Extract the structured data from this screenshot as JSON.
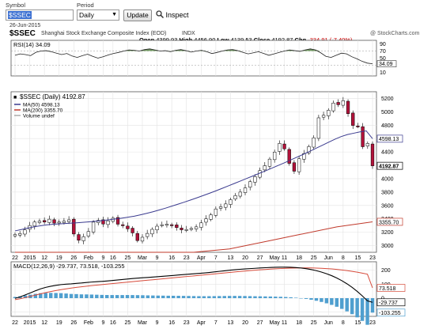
{
  "toolbar": {
    "symbol_caption": "Symbol",
    "symbol_value": "$SSEC",
    "period_caption": "Period",
    "period_value": "Daily",
    "update_label": "Update",
    "inspect_label": "Inspect"
  },
  "header": {
    "date": "26-Jun-2015",
    "symbol": "$SSEC",
    "name": "Shanghai Stock Exchange Composite Index (EOD)",
    "exchange": "INDX",
    "watermark": "@ StockCharts.com",
    "open_label": "Open",
    "open_value": "4399.93",
    "high_label": "High",
    "high_value": "4456.90",
    "low_label": "Low",
    "low_value": "4139.53",
    "close_label": "Close",
    "close_value": "4192.87",
    "chg_label": "Chg",
    "chg_value": "-334.91 (-7.40%)"
  },
  "colors": {
    "up_candle": "#ffffff",
    "down_candle": "#b2123a",
    "ma50": "#3b3b8f",
    "ma200": "#c0392b",
    "rsi_fill": "#5d8a4a",
    "macd": "#000000",
    "signal": "#d64a3a",
    "histogram": "#4f9fcf"
  },
  "chart_data": [
    {
      "type": "line",
      "panel": "rsi",
      "legend": "RSI(14) 34.09",
      "current_value": "34.09",
      "y_ticks": [
        "90",
        "70",
        "50",
        "30",
        "10"
      ],
      "ylim": [
        0,
        100
      ],
      "reference_levels": [
        70,
        30
      ],
      "series": [
        {
          "name": "RSI(14)",
          "values": [
            58,
            62,
            60,
            57,
            66,
            70,
            71,
            68,
            64,
            60,
            63,
            56,
            52,
            57,
            61,
            55,
            50,
            54,
            59,
            63,
            66,
            70,
            73,
            72,
            70,
            74,
            76,
            73,
            70,
            71,
            68,
            72,
            74,
            71,
            67,
            70,
            72,
            68,
            63,
            66,
            70,
            73,
            74,
            71,
            66,
            62,
            65,
            68,
            63,
            58,
            62,
            66,
            70,
            73,
            71,
            69,
            73,
            76,
            73,
            65,
            55,
            52,
            58,
            64,
            62,
            54,
            48,
            41,
            36,
            34.09
          ]
        }
      ]
    },
    {
      "type": "candlestick",
      "panel": "price",
      "legend_title": "$SSEC (Daily) 4192.87",
      "legend_items": [
        "MA(50) 4598.13",
        "MA(200) 3355.70",
        "Volume undef"
      ],
      "y_ticks": [
        "5200",
        "5000",
        "4800",
        "4600",
        "4400",
        "4200",
        "4000",
        "3800",
        "3600",
        "3400",
        "3200",
        "3000"
      ],
      "ylim": [
        2900,
        5300
      ],
      "value_labels": [
        "4598.13",
        "4192.87",
        "3355.70"
      ],
      "close": [
        3165,
        3180,
        3235,
        3300,
        3352,
        3365,
        3352,
        3395,
        3336,
        3352,
        3365,
        3385,
        3173,
        3080,
        3132,
        3210,
        3351,
        3376,
        3323,
        3370,
        3410,
        3320,
        3300,
        3250,
        3190,
        3075,
        3125,
        3182,
        3243,
        3290,
        3312,
        3320,
        3300,
        3270,
        3236,
        3240,
        3256,
        3280,
        3340,
        3400,
        3460,
        3548,
        3580,
        3623,
        3686,
        3747,
        3800,
        3862,
        3955,
        4030,
        4121,
        4194,
        4293,
        4398,
        4527,
        4446,
        4229,
        4112,
        4298,
        4375,
        4480,
        4611,
        4910,
        4948,
        5023,
        5131,
        5106,
        5166,
        4972,
        4796,
        4786,
        4478,
        4527,
        4192.87
      ],
      "series": [
        {
          "name": "MA(50)",
          "values": [
            3220,
            3240,
            3262,
            3280,
            3296,
            3310,
            3318,
            3324,
            3330,
            3336,
            3342,
            3349,
            3357,
            3366,
            3376,
            3386,
            3398,
            3410,
            3424,
            3440,
            3460,
            3482,
            3506,
            3532,
            3560,
            3590,
            3620,
            3650,
            3682,
            3714,
            3748,
            3782,
            3818,
            3855,
            3892,
            3930,
            3968,
            4006,
            4044,
            4082,
            4120,
            4160,
            4200,
            4240,
            4282,
            4324,
            4366,
            4410,
            4455,
            4500,
            4545,
            4590,
            4630,
            4660,
            4680,
            4700,
            4715,
            4598.13
          ]
        },
        {
          "name": "MA(200)",
          "values": [
            2290,
            2400,
            2510,
            2620,
            2730,
            2840,
            2950,
            3060,
            3170,
            3280,
            3355.7
          ]
        }
      ]
    },
    {
      "type": "line",
      "panel": "macd",
      "legend": "MACD(12,26,9) -29.737, 73.518, -103.255",
      "value_labels": [
        "73.518",
        "-29.737",
        "-103.255"
      ],
      "y_ticks": [
        "200",
        "100",
        "0",
        "-100"
      ],
      "ylim": [
        -130,
        260
      ],
      "series": [
        {
          "name": "MACD",
          "values": [
            -1.5,
            9.1,
            23.1,
            37.2,
            52.7,
            66.5,
            77.0,
            85.2,
            91.7,
            96.8,
            99.9,
            102.0,
            105.8,
            108.3,
            112.1,
            115.1,
            117.7,
            120.0,
            122.8,
            126.0,
            129.4,
            133.0,
            136.7,
            140.0,
            143.0,
            145.7,
            148.2,
            150.7,
            153.5,
            156.3,
            159.2,
            162.4,
            165.6,
            168.6,
            171.4,
            174.1,
            176.9,
            180.0,
            183.6,
            187.4,
            191.4,
            195.5,
            199.5,
            203.1,
            206.3,
            209.0,
            211.3,
            213.4,
            215.6,
            217.6,
            219.3,
            220.6,
            221.4,
            221.5,
            220.8,
            218.8,
            215.5,
            210.9,
            204.6,
            196.5,
            186.6,
            174.7,
            160.7,
            144.1,
            124.8,
            102.6,
            77.2,
            48.4,
            16.3,
            -19.0,
            -29.737
          ]
        },
        {
          "name": "Signal",
          "values": [
            -10.3,
            -4.1,
            3.9,
            12.6,
            21.8,
            31.0,
            39.6,
            47.5,
            54.7,
            61.0,
            66.7,
            71.9,
            76.7,
            81.2,
            85.4,
            89.4,
            93.1,
            96.7,
            100.2,
            103.7,
            107.2,
            110.8,
            114.3,
            117.9,
            121.4,
            124.9,
            128.3,
            131.7,
            135.1,
            138.4,
            141.8,
            145.3,
            148.8,
            152.3,
            155.8,
            159.3,
            162.7,
            166.1,
            169.5,
            173.0,
            176.5,
            180.1,
            183.6,
            187.1,
            190.5,
            193.8,
            196.9,
            199.8,
            202.5,
            205.1,
            207.5,
            209.7,
            211.6,
            213.2,
            214.5,
            215.5,
            216.1,
            216.3,
            216.0,
            215.1,
            213.6,
            211.5,
            208.8,
            205.5,
            201.5,
            196.9,
            191.6,
            185.6,
            178.8,
            171.3,
            73.518
          ]
        }
      ]
    }
  ],
  "x_axis": {
    "tick_labels": [
      "22",
      "2015",
      "12",
      "19",
      "26",
      "Feb",
      "9",
      "16",
      "25",
      "Mar",
      "9",
      "16",
      "23",
      "Apr",
      "7",
      "13",
      "20",
      "27",
      "May",
      "11",
      "18",
      "25",
      "Jun",
      "8",
      "15",
      "23"
    ]
  }
}
